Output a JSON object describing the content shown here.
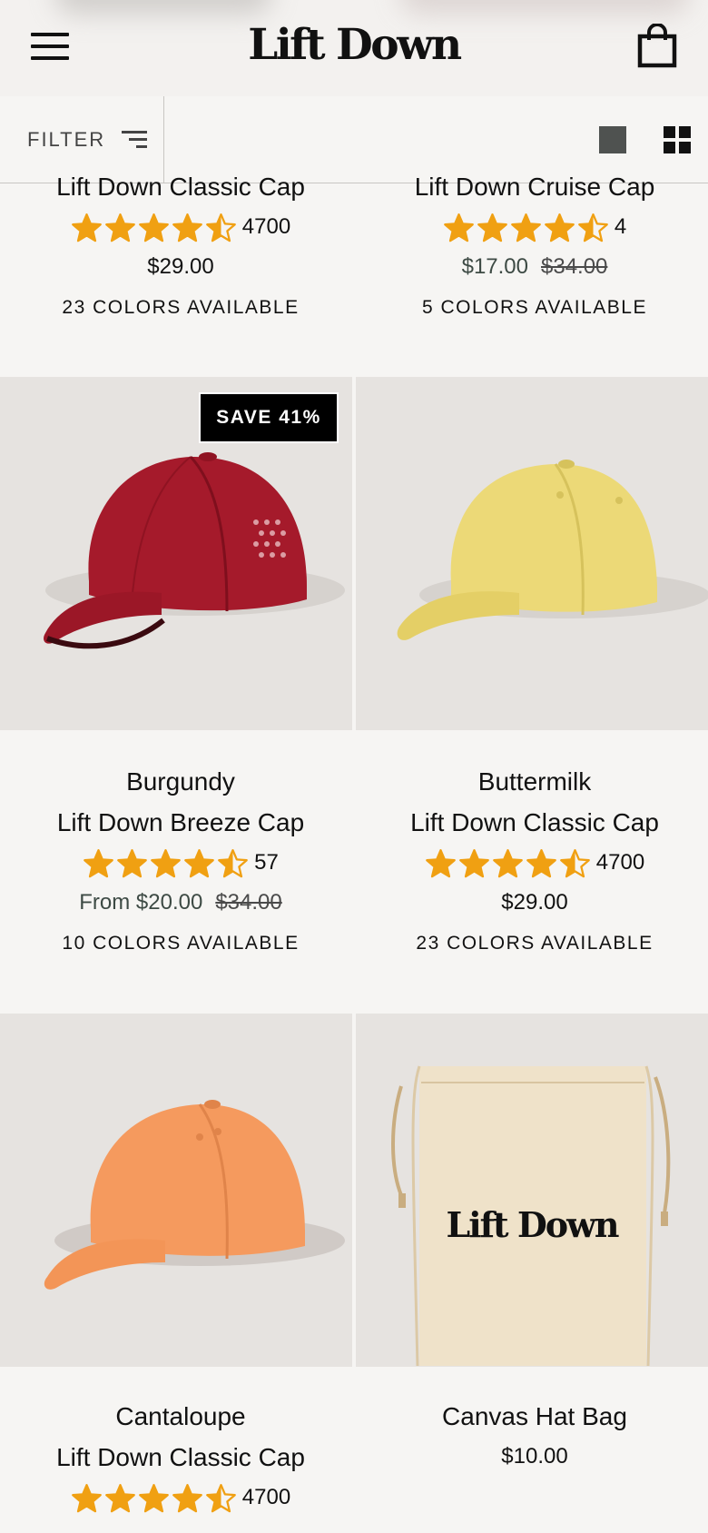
{
  "header": {
    "logo": "Lift Down"
  },
  "filter": {
    "label": "FILTER"
  },
  "products": [
    {
      "title": "Lift Down Classic Cap",
      "rating_count": "4700",
      "price": "$29.00",
      "colors": "23 COLORS AVAILABLE"
    },
    {
      "title": "Lift Down Cruise Cap",
      "rating_count": "4",
      "price": "$17.00",
      "compare_price": "$34.00",
      "colors": "5 COLORS AVAILABLE"
    },
    {
      "color_name": "Burgundy",
      "title": "Lift Down Breeze Cap",
      "rating_count": "57",
      "price": "From $20.00",
      "compare_price": "$34.00",
      "colors": "10 COLORS AVAILABLE",
      "badge": "SAVE 41%",
      "cap_color": "#a51a2b"
    },
    {
      "color_name": "Buttermilk",
      "title": "Lift Down Classic Cap",
      "rating_count": "4700",
      "price": "$29.00",
      "colors": "23 COLORS AVAILABLE",
      "cap_color": "#ecd977"
    },
    {
      "color_name": "Cantaloupe",
      "title": "Lift Down Classic Cap",
      "rating_count": "4700",
      "cap_color": "#f59a5e"
    },
    {
      "title": "Canvas Hat Bag",
      "price": "$10.00",
      "bag_logo": "Lift Down"
    }
  ],
  "colors": {
    "star": "#f0a012",
    "tile_bg": "#e6e3e0",
    "page_bg": "#f6f5f3"
  }
}
